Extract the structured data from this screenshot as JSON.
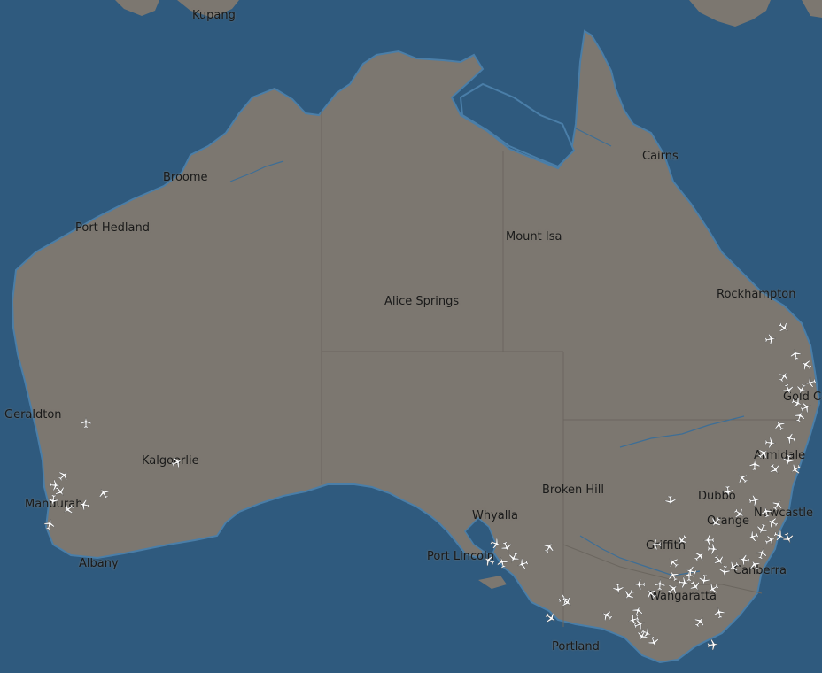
{
  "map": {
    "colors": {
      "ocean": "#2f5a7e",
      "land": "#7c7770",
      "coast": "#4a7ea8",
      "border": "#6b665f",
      "river": "#3d6e96",
      "label": "#1a1a1a",
      "aircraft": "#ffffff"
    },
    "labels": {
      "kupang": "Kupang",
      "broome": "Broome",
      "port_hedland": "Port Hedland",
      "mount_isa": "Mount Isa",
      "cairns": "Cairns",
      "rockhampton": "Rockhampton",
      "alice_springs": "Alice Springs",
      "geraldton": "Geraldton",
      "kalgoorlie": "Kalgoorlie",
      "mandurah": "Mandurah",
      "albany": "Albany",
      "broken_hill": "Broken Hill",
      "whyalla": "Whyalla",
      "port_lincoln": "Port Lincoln",
      "dubbo": "Dubbo",
      "orange": "Orange",
      "newcastle": "Newcastle",
      "armidale": "Armidale",
      "gold_coast": "Gold Coast",
      "griffith": "Griffith",
      "canberra": "Canberra",
      "wangaratta": "Wangaratta",
      "portland": "Portland"
    },
    "aircraft_icon": "airplane-icon"
  }
}
